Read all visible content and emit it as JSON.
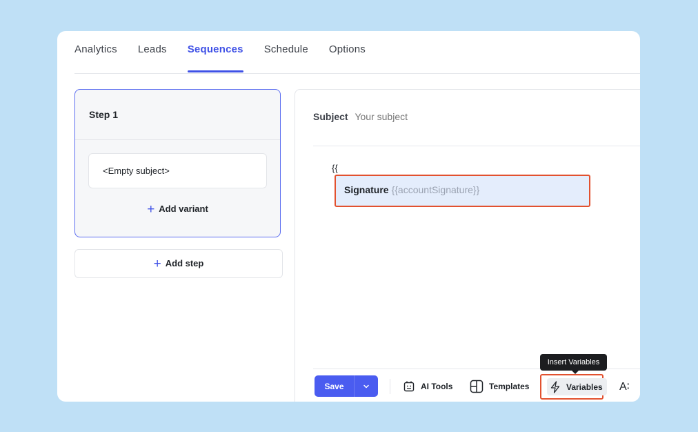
{
  "tabs": [
    {
      "label": "Analytics",
      "active": false
    },
    {
      "label": "Leads",
      "active": false
    },
    {
      "label": "Sequences",
      "active": true
    },
    {
      "label": "Schedule",
      "active": false
    },
    {
      "label": "Options",
      "active": false
    }
  ],
  "steps": {
    "step_title": "Step 1",
    "variant_subject": "<Empty subject>",
    "add_variant_label": "Add variant",
    "add_step_label": "Add step"
  },
  "editor": {
    "subject_label": "Subject",
    "subject_placeholder": "Your subject",
    "body_text": "{{",
    "suggestion": {
      "name": "Signature",
      "variable": "{{accountSignature}}"
    }
  },
  "toolbar": {
    "save_label": "Save",
    "ai_tools_label": "AI Tools",
    "templates_label": "Templates",
    "variables_label": "Variables",
    "variables_tooltip": "Insert Variables",
    "font_label": "A∶"
  },
  "colors": {
    "accent": "#3f51e6",
    "save_button": "#4a5cf0",
    "highlight_border": "#e2512f",
    "suggestion_bg": "#e4edfc",
    "page_bg": "#bfe0f6"
  }
}
